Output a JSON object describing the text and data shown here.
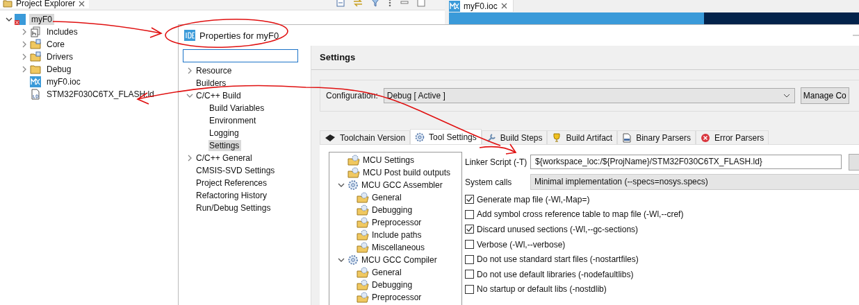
{
  "explorer": {
    "title": "Project Explorer",
    "tree": [
      {
        "label": "myF0",
        "kind": "project",
        "expanded": true,
        "selected": true,
        "children": [
          {
            "label": "Includes",
            "kind": "includes",
            "expanded": false,
            "selected": false
          },
          {
            "label": "Core",
            "kind": "source-folder",
            "expanded": false,
            "selected": false
          },
          {
            "label": "Drivers",
            "kind": "source-folder",
            "expanded": false,
            "selected": false
          },
          {
            "label": "Debug",
            "kind": "folder",
            "expanded": false,
            "selected": false
          },
          {
            "label": "myF0.ioc",
            "kind": "mx",
            "selected": false
          },
          {
            "label": "STM32F030C6TX_FLASH.ld",
            "kind": "ld",
            "selected": false
          }
        ]
      }
    ]
  },
  "editor": {
    "tab": {
      "label": "myF0.ioc",
      "kind": "mx"
    }
  },
  "dialog": {
    "title": "Properties for myF0",
    "nav": [
      {
        "label": "Resource",
        "kind": "folder",
        "expanded": false,
        "selected": false
      },
      {
        "label": "Builders",
        "kind": "leaf",
        "selected": false
      },
      {
        "label": "C/C++ Build",
        "kind": "folder",
        "expanded": true,
        "selected": false,
        "children": [
          {
            "label": "Build Variables",
            "selected": false
          },
          {
            "label": "Environment",
            "selected": false
          },
          {
            "label": "Logging",
            "selected": false
          },
          {
            "label": "Settings",
            "selected": true
          }
        ]
      },
      {
        "label": "C/C++ General",
        "kind": "folder",
        "expanded": false,
        "selected": false
      },
      {
        "label": "CMSIS-SVD Settings",
        "kind": "leaf",
        "selected": false
      },
      {
        "label": "Project References",
        "kind": "leaf",
        "selected": false
      },
      {
        "label": "Refactoring History",
        "kind": "leaf",
        "selected": false
      },
      {
        "label": "Run/Debug Settings",
        "kind": "leaf",
        "selected": false
      }
    ],
    "page_title": "Settings",
    "configuration": {
      "label": "Configuration:",
      "value": "Debug  [ Active ]"
    },
    "manage_button": "Manage Co",
    "tabs": [
      {
        "label": "Toolchain Version",
        "kind": "chip",
        "selected": false
      },
      {
        "label": "Tool Settings",
        "kind": "gear",
        "selected": true
      },
      {
        "label": "Build Steps",
        "kind": "wrench",
        "selected": false
      },
      {
        "label": "Build Artifact",
        "kind": "trophy",
        "selected": false
      },
      {
        "label": "Binary Parsers",
        "kind": "binary",
        "selected": false
      },
      {
        "label": "Error Parsers",
        "kind": "error",
        "selected": false
      }
    ],
    "tool_tree": [
      {
        "label": "MCU Settings",
        "kind": "leaf"
      },
      {
        "label": "MCU Post build outputs",
        "kind": "leaf"
      },
      {
        "label": "MCU GCC Assembler",
        "kind": "tool",
        "expanded": true,
        "children": [
          {
            "label": "General"
          },
          {
            "label": "Debugging"
          },
          {
            "label": "Preprocessor"
          },
          {
            "label": "Include paths"
          },
          {
            "label": "Miscellaneous"
          }
        ]
      },
      {
        "label": "MCU GCC Compiler",
        "kind": "tool",
        "expanded": true,
        "children": [
          {
            "label": "General"
          },
          {
            "label": "Debugging"
          },
          {
            "label": "Preprocessor"
          }
        ]
      }
    ],
    "linker_script": {
      "label": "Linker Script (-T)",
      "value": "${workspace_loc:/${ProjName}/STM32F030C6TX_FLASH.ld}"
    },
    "system_calls": {
      "label": "System calls",
      "value": "Minimal implementation (--specs=nosys.specs)"
    },
    "options": [
      {
        "label": "Generate map file (-Wl,-Map=)",
        "checked": true
      },
      {
        "label": "Add symbol cross reference table to map file (-Wl,--cref)",
        "checked": false
      },
      {
        "label": "Discard unused sections (-Wl,--gc-sections)",
        "checked": true
      },
      {
        "label": "Verbose (-Wl,--verbose)",
        "checked": false
      },
      {
        "label": "Do not use standard start files (-nostartfiles)",
        "checked": false
      },
      {
        "label": "Do not use default libraries (-nodefaultlibs)",
        "checked": false
      },
      {
        "label": "No startup or default libs (-nostdlib)",
        "checked": false
      }
    ]
  }
}
